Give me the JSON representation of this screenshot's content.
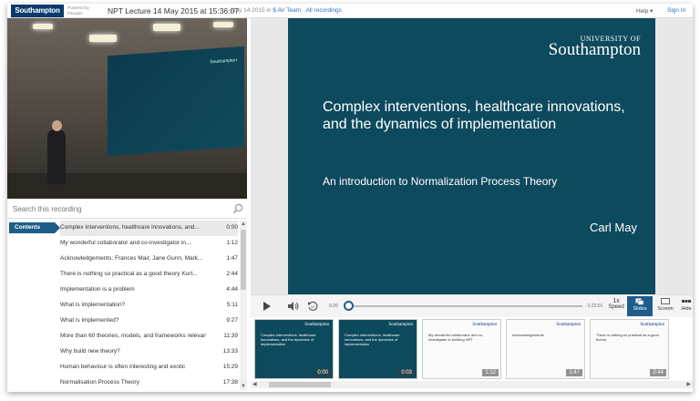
{
  "header": {
    "logo_text": "Southampton",
    "powered_by": "Powered by Panopto",
    "title": "NPT Lecture 14 May 2015 at 15:36:07",
    "date": "May 14 2015 in",
    "folder_link": "$ AV Team",
    "separator": " · ",
    "all_recordings": "All recordings",
    "help": "Help ▾",
    "sign_in": "Sign In"
  },
  "search": {
    "placeholder": "Search this recording"
  },
  "contents": {
    "tab_label": "Contents",
    "items": [
      {
        "label": "Complex interventions, healthcare innovations, and...",
        "time": "0:00"
      },
      {
        "label": "My wonderful collaborator and co-investigator in...",
        "time": "1:12"
      },
      {
        "label": "Acknowledgements: Frances Mair, Jane Gunn, Mark...",
        "time": "1:47"
      },
      {
        "label": "There is nothing so practical as a good theory Kurt...",
        "time": "2:44"
      },
      {
        "label": "Implementation is a problem",
        "time": "4:44"
      },
      {
        "label": "What is implementation?",
        "time": "5:11"
      },
      {
        "label": "What is implemented?",
        "time": "9:27"
      },
      {
        "label": "More than 60 theories, models, and frameworks relevant...",
        "time": "11:39"
      },
      {
        "label": "Why build new theory?",
        "time": "13:33"
      },
      {
        "label": "Human behaviour is often interesting and exotic",
        "time": "15:29"
      },
      {
        "label": "Normalisation Process Theory",
        "time": "17:38"
      }
    ]
  },
  "slide": {
    "uni_top": "UNIVERSITY OF",
    "uni_name": "Southampton",
    "title": "Complex interventions, healthcare innovations, and the dynamics of implementation",
    "subtitle": "An introduction to Normalization Process Theory",
    "author": "Carl May"
  },
  "player": {
    "elapsed": "0:26",
    "remaining": "-1:22:01",
    "progress": 0.005,
    "speed_value": "1x",
    "speed_label": "Speed",
    "slides_label": "Slides",
    "screen_label": "Screen",
    "hide_label": "Hide"
  },
  "thumbnails": [
    {
      "time": "0:00",
      "kind": "dark",
      "text": "Complex interventions, healthcare innovations, and the dynamics of implementation"
    },
    {
      "time": "0:03",
      "kind": "dark",
      "text": "Complex interventions, healthcare innovations, and the dynamics of implementation"
    },
    {
      "time": "1:12",
      "kind": "light",
      "text": "My wonderful collaborator and co-investigator in building NPT"
    },
    {
      "time": "1:47",
      "kind": "light",
      "text": "Acknowledgements"
    },
    {
      "time": "2:44",
      "kind": "light",
      "text": "There is nothing so practical as a good theory"
    }
  ],
  "colors": {
    "brand": "#0a3a6b",
    "accent": "#1e5d8a",
    "slide_bg": "#0e4a5e"
  }
}
